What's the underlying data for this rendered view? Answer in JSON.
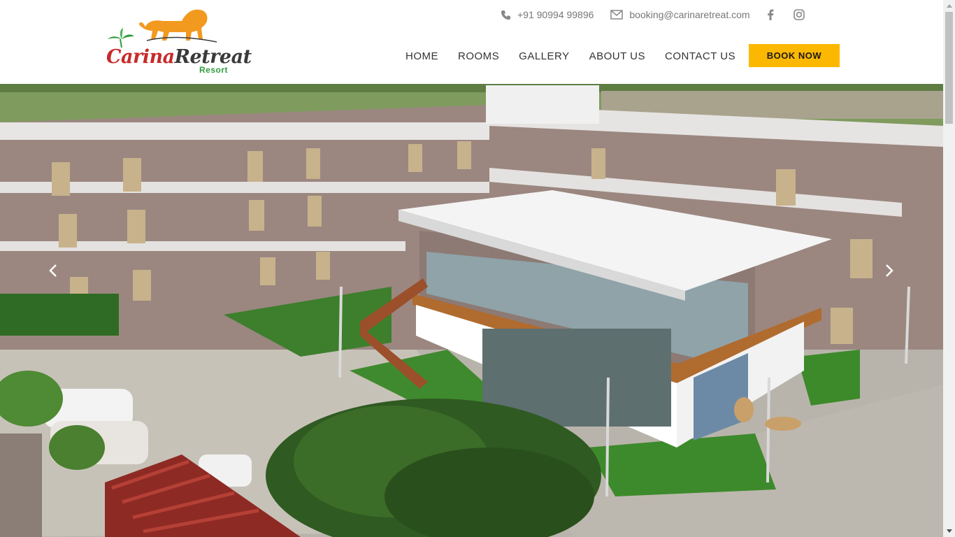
{
  "brand": {
    "name_part1": "Carina",
    "name_part2": "Retreat",
    "sub": "Resort"
  },
  "topbar": {
    "phone": "+91 90994 99896",
    "email": "booking@carinaretreat.com",
    "social": [
      "facebook-icon",
      "instagram-icon"
    ]
  },
  "nav": {
    "items": [
      "HOME",
      "ROOMS",
      "GALLERY",
      "ABOUT US",
      "CONTACT US"
    ],
    "cta": "BOOK NOW"
  },
  "colors": {
    "accent": "#fcb800",
    "logo_red": "#c72a2a",
    "logo_green": "#2e9c3f",
    "logo_orange": "#f29a1f"
  },
  "hero": {
    "prev_icon": "chevron-left-icon",
    "next_icon": "chevron-right-icon"
  }
}
